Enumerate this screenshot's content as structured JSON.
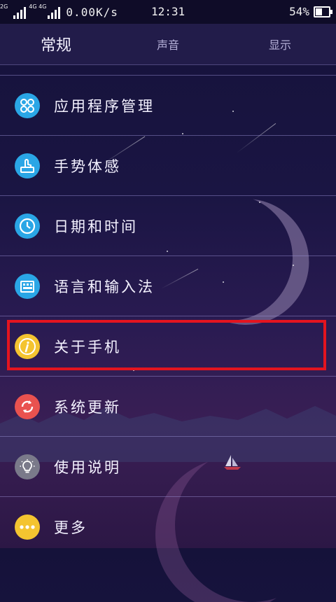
{
  "status_bar": {
    "network_label_1": "2G",
    "network_label_2": "4G 4G",
    "speed": "0.00K/s",
    "time": "12:31",
    "battery": "54%",
    "battery_level": 0.54
  },
  "tabs": [
    {
      "label": "常规",
      "active": true
    },
    {
      "label": "声音",
      "active": false
    },
    {
      "label": "显示",
      "active": false
    }
  ],
  "menu": [
    {
      "label": "应用程序管理",
      "icon": "apps-grid-icon",
      "color": "#2aa6e6"
    },
    {
      "label": "手势体感",
      "icon": "gesture-hand-icon",
      "color": "#2aa6e6"
    },
    {
      "label": "日期和时间",
      "icon": "clock-icon",
      "color": "#2aa6e6"
    },
    {
      "label": "语言和输入法",
      "icon": "keyboard-icon",
      "color": "#2aa6e6"
    },
    {
      "label": "关于手机",
      "icon": "info-icon",
      "color": "#f4c430"
    },
    {
      "label": "系统更新",
      "icon": "refresh-icon",
      "color": "#e9524f"
    },
    {
      "label": "使用说明",
      "icon": "lightbulb-icon",
      "color": "#7a7a8a"
    },
    {
      "label": "更多",
      "icon": "more-dots-icon",
      "color": "#f4c430"
    }
  ],
  "colors": {
    "highlight": "#e4141f"
  }
}
